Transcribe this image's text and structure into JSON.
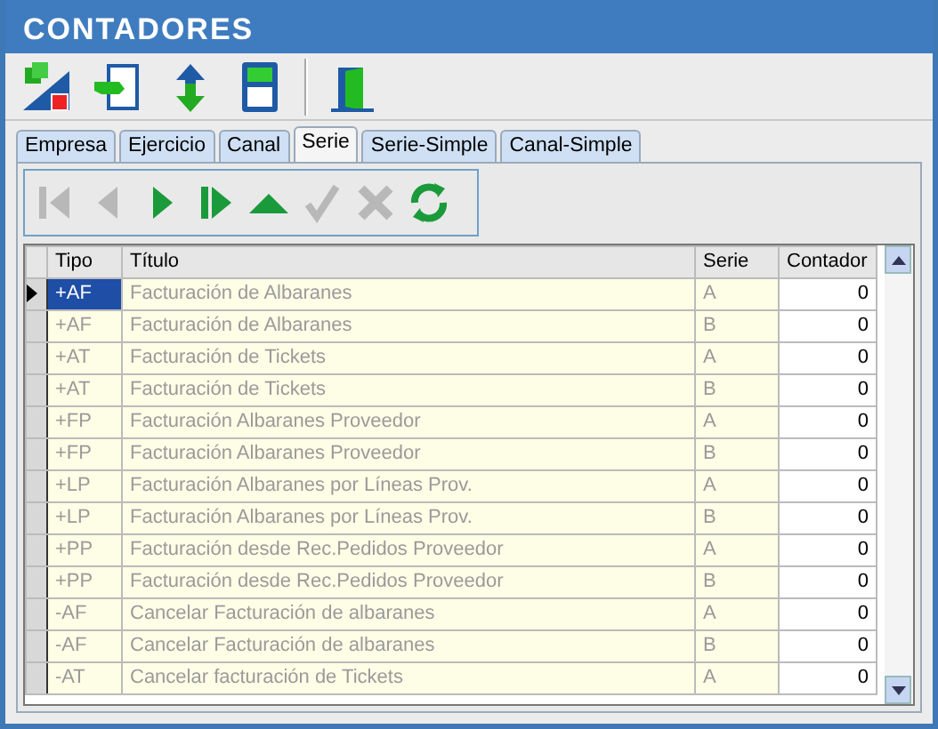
{
  "window": {
    "title": "CONTADORES"
  },
  "toolbar": [
    {
      "kind": "import"
    },
    {
      "kind": "hand"
    },
    {
      "kind": "updown"
    },
    {
      "kind": "calculator"
    },
    {
      "kind": "separator"
    },
    {
      "kind": "exit"
    }
  ],
  "tabs": [
    {
      "label": "Empresa",
      "selected": false
    },
    {
      "label": "Ejercicio",
      "selected": false
    },
    {
      "label": "Canal",
      "selected": false
    },
    {
      "label": "Serie",
      "selected": true
    },
    {
      "label": "Serie-Simple",
      "selected": false
    },
    {
      "label": "Canal-Simple",
      "selected": false
    }
  ],
  "navigator": [
    {
      "kind": "first",
      "disabled": true
    },
    {
      "kind": "prior",
      "disabled": true
    },
    {
      "kind": "next",
      "disabled": false
    },
    {
      "kind": "last",
      "disabled": false
    },
    {
      "kind": "insert",
      "disabled": false
    },
    {
      "kind": "post",
      "disabled": true
    },
    {
      "kind": "cancel",
      "disabled": true
    },
    {
      "kind": "refresh",
      "disabled": false
    }
  ],
  "table": {
    "columns": [
      "Tipo",
      "Título",
      "Serie",
      "Contador"
    ],
    "rows": [
      {
        "cells": [
          "+AF",
          "Facturación de Albaranes",
          "A",
          "0"
        ],
        "selected": true
      },
      {
        "cells": [
          "+AF",
          "Facturación de Albaranes",
          "B",
          "0"
        ],
        "selected": false
      },
      {
        "cells": [
          "+AT",
          "Facturación de Tickets",
          "A",
          "0"
        ],
        "selected": false
      },
      {
        "cells": [
          "+AT",
          "Facturación de Tickets",
          "B",
          "0"
        ],
        "selected": false
      },
      {
        "cells": [
          "+FP",
          "Facturación Albaranes Proveedor",
          "A",
          "0"
        ],
        "selected": false
      },
      {
        "cells": [
          "+FP",
          "Facturación Albaranes Proveedor",
          "B",
          "0"
        ],
        "selected": false
      },
      {
        "cells": [
          "+LP",
          "Facturación Albaranes por Líneas Prov.",
          "A",
          "0"
        ],
        "selected": false
      },
      {
        "cells": [
          "+LP",
          "Facturación Albaranes por Líneas Prov.",
          "B",
          "0"
        ],
        "selected": false
      },
      {
        "cells": [
          "+PP",
          "Facturación desde Rec.Pedidos Proveedor",
          "A",
          "0"
        ],
        "selected": false
      },
      {
        "cells": [
          "+PP",
          "Facturación desde Rec.Pedidos Proveedor",
          "B",
          "0"
        ],
        "selected": false
      },
      {
        "cells": [
          "-AF",
          "Cancelar Facturación de albaranes",
          "A",
          "0"
        ],
        "selected": false
      },
      {
        "cells": [
          "-AF",
          "Cancelar Facturación de albaranes",
          "B",
          "0"
        ],
        "selected": false
      },
      {
        "cells": [
          "-AT",
          "Cancelar facturación de Tickets",
          "A",
          "0"
        ],
        "selected": false
      }
    ]
  }
}
